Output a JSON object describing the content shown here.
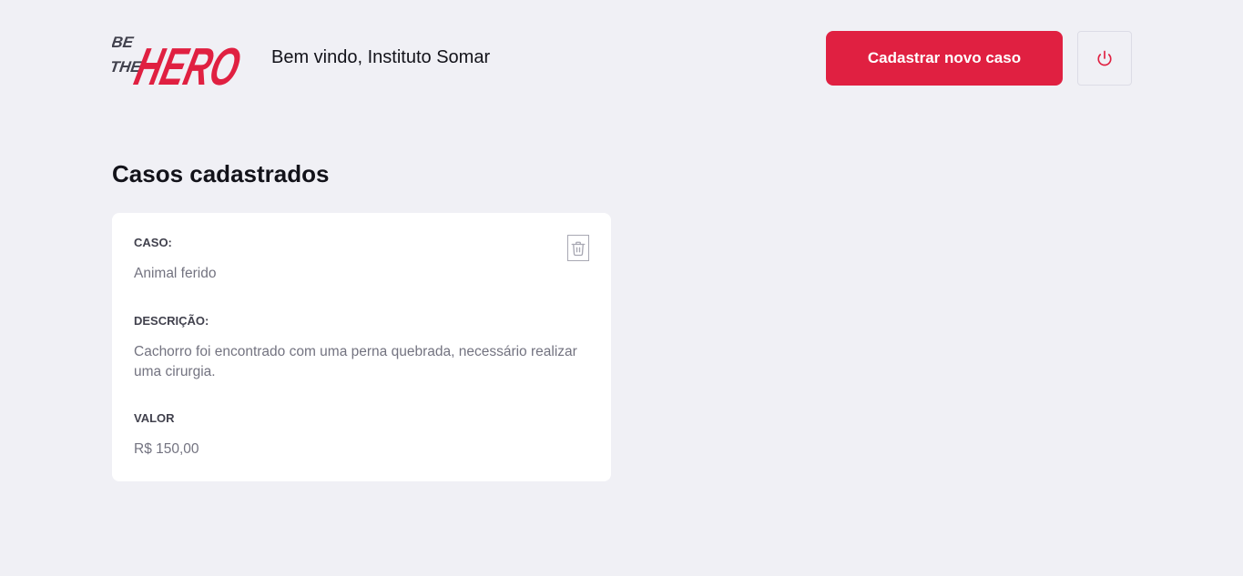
{
  "header": {
    "logo_text": "BE THE HERO",
    "welcome": "Bem vindo, Instituto Somar",
    "new_case_label": "Cadastrar novo caso",
    "logout_icon": "power-icon"
  },
  "main": {
    "title": "Casos cadastrados",
    "cases": [
      {
        "case_label": "CASO:",
        "case_value": "Animal ferido",
        "description_label": "DESCRIÇÃO:",
        "description_value": "Cachorro foi encontrado com uma perna quebrada, necessário realizar uma cirurgia.",
        "value_label": "VALOR",
        "value_value": "R$ 150,00",
        "delete_icon": "trash-icon"
      }
    ]
  },
  "colors": {
    "brand": "#e02041",
    "background": "#f0f0f5",
    "card": "#ffffff"
  }
}
